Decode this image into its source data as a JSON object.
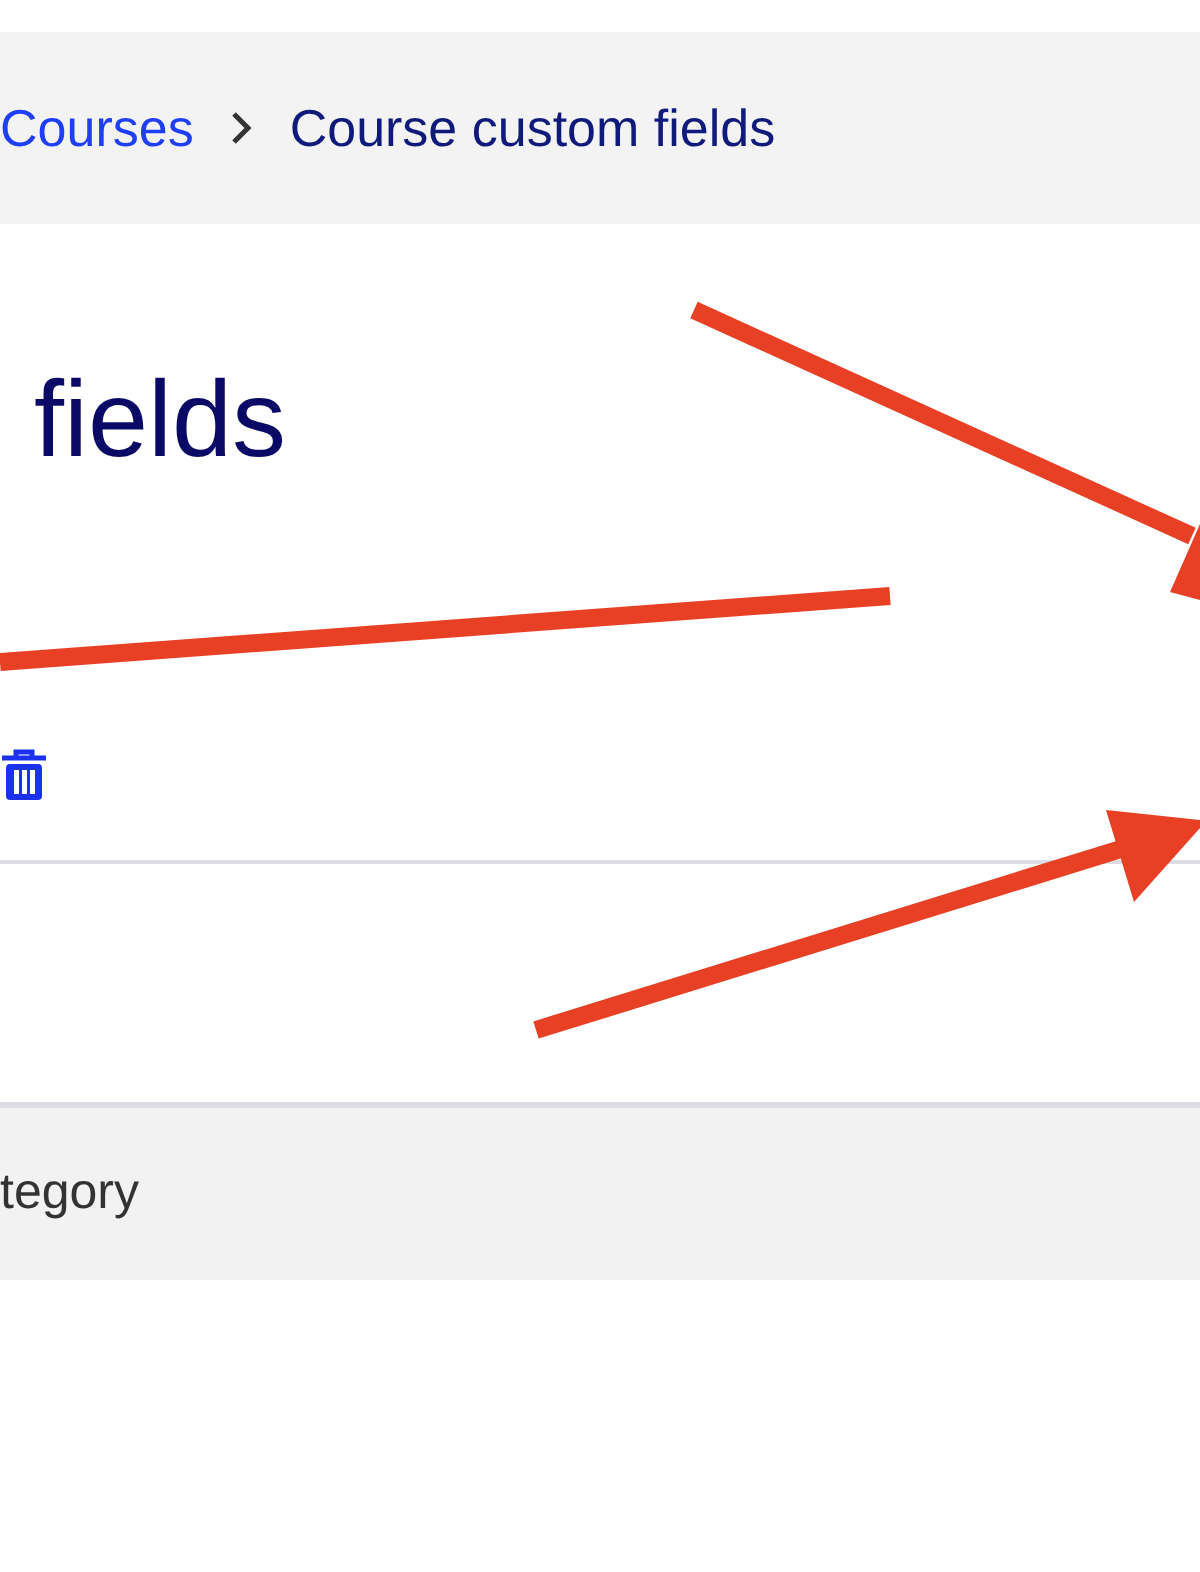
{
  "breadcrumb": [
    {
      "label": "Courses",
      "current": false
    },
    {
      "label": "Course custom fields",
      "current": true
    }
  ],
  "heading": "fields",
  "table_header": {
    "column_1": "tegory"
  }
}
